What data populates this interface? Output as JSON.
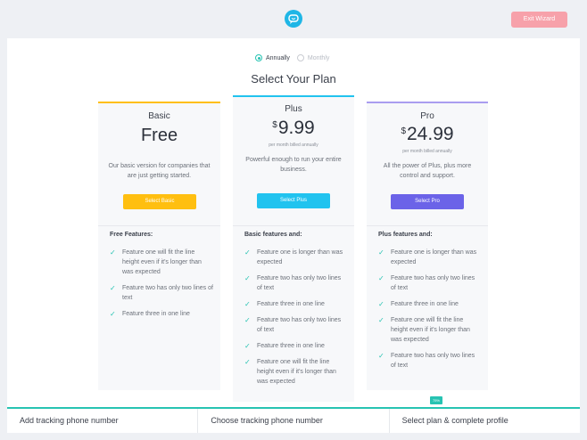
{
  "topbar": {
    "logo_icon": "chat-bubble-logo",
    "exit_label": "Exit Wizard"
  },
  "billing": {
    "annually_label": "Annually",
    "monthly_label": "Monthly",
    "selected": "Annually"
  },
  "heading": "Select Your Plan",
  "plans": [
    {
      "name": "Basic",
      "price": "Free",
      "currency": "",
      "billed": "",
      "description": "Our basic version for companies that are just getting started.",
      "button": "Select Basic",
      "accent": "#ffbf10",
      "features_title": "Free Features:",
      "features": [
        "Feature one will fit the line height even if it's longer than was expected",
        "Feature two has only two lines of text",
        "Feature three in one line"
      ]
    },
    {
      "name": "Plus",
      "price": "9.99",
      "currency": "$",
      "billed": "per month billed annually",
      "description": "Powerful enough to run your entire business.",
      "button": "Select Plus",
      "accent": "#21c3ef",
      "features_title": "Basic features and:",
      "features": [
        "Feature one is longer than was expected",
        "Feature two has only two lines of text",
        "Feature three in one line",
        "Feature two has only two lines of text",
        "Feature three in one line",
        "Feature one will fit the line height even if it's longer than was expected"
      ]
    },
    {
      "name": "Pro",
      "price": "24.99",
      "currency": "$",
      "billed": "per month billed annually",
      "description": "All the power of Plus, plus more control and support.",
      "button": "Select Pro",
      "accent": "#6b63e8",
      "features_title": "Plus features and:",
      "features": [
        "Feature one is longer than was expected",
        "Feature two has only two lines of text",
        "Feature three in one line",
        "Feature one will fit the line height even if it's longer than was expected",
        "Feature two has only two lines of text"
      ]
    }
  ],
  "steps": [
    "Add tracking phone number",
    "Choose tracking phone number",
    "Select plan & complete profile"
  ],
  "progress_badge": "75%",
  "colors": {
    "teal": "#27c3b2",
    "exit": "#f7a1aa"
  }
}
